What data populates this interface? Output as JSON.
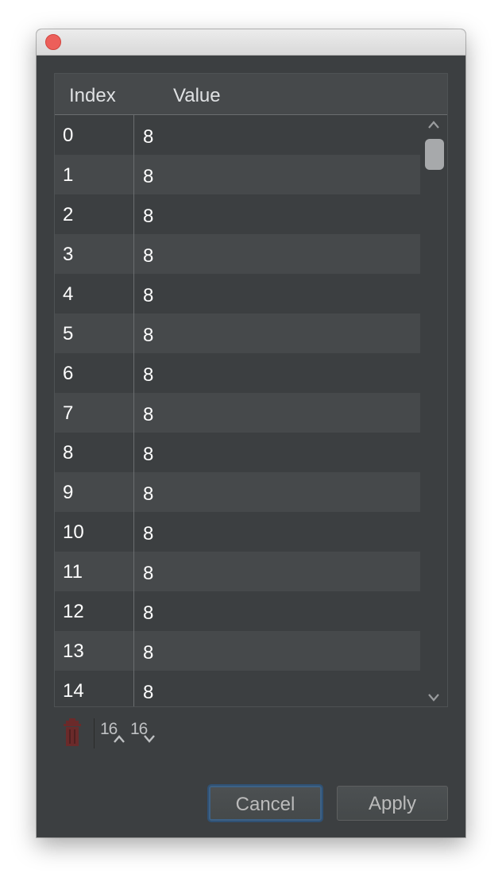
{
  "table": {
    "columns": {
      "index": "Index",
      "value": "Value"
    },
    "rows": [
      {
        "index": "0",
        "value": "8"
      },
      {
        "index": "1",
        "value": "8"
      },
      {
        "index": "2",
        "value": "8"
      },
      {
        "index": "3",
        "value": "8"
      },
      {
        "index": "4",
        "value": "8"
      },
      {
        "index": "5",
        "value": "8"
      },
      {
        "index": "6",
        "value": "8"
      },
      {
        "index": "7",
        "value": "8"
      },
      {
        "index": "8",
        "value": "8"
      },
      {
        "index": "9",
        "value": "8"
      },
      {
        "index": "10",
        "value": "8"
      },
      {
        "index": "11",
        "value": "8"
      },
      {
        "index": "12",
        "value": "8"
      },
      {
        "index": "13",
        "value": "8"
      },
      {
        "index": "14",
        "value": "8"
      }
    ],
    "scroll_position": 0.0
  },
  "toolbar": {
    "delete_icon": "trash-icon",
    "hex_up_label": "16",
    "hex_down_label": "16"
  },
  "buttons": {
    "cancel": "Cancel",
    "apply": "Apply"
  },
  "colors": {
    "window_bg": "#3c3f41",
    "close_button": "#ec5f5a",
    "trash_disabled": "#6b2a2a",
    "focus_ring": "#3d6185"
  }
}
